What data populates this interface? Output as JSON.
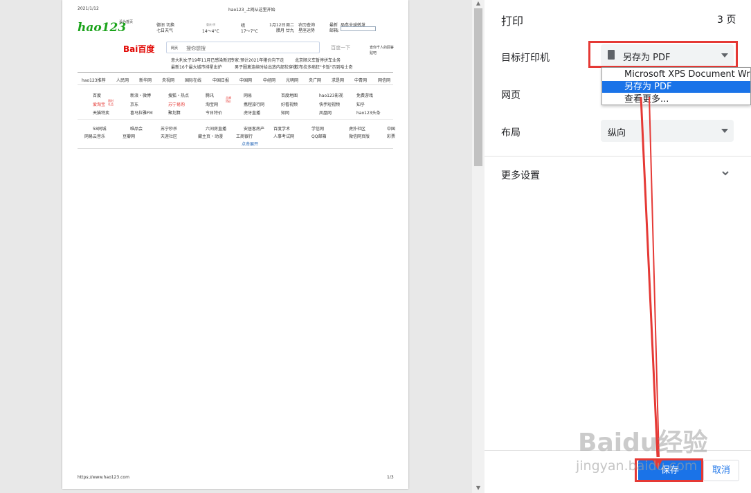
{
  "preview": {
    "header_date": "2021/1/12",
    "header_title": "hao123_上网从这里开始",
    "footer_url": "https://www.hao123.com",
    "footer_page": "1/3",
    "logo_hao": "hao123",
    "set_home": "设为首页",
    "weather": {
      "city": "德旧",
      "switch": "切换",
      "week_weather": "七日天气",
      "today_label": "重庆·阴",
      "today_temp": "14～4°C",
      "tomorrow_label": "晴",
      "tomorrow_temp": "17～7°C",
      "date": "1月12日",
      "weekday": "周二",
      "lunar": "腊月 廿九",
      "search_stock": "农历查询",
      "gold": "星座运势",
      "hot_label": "最新",
      "hot_text": "局参全球转发",
      "mail_label": "邮箱:"
    },
    "baidu_logo": "Bai百度",
    "search_tab": "网页",
    "search_placeholder": "搜你想搜",
    "search_button": "百度一下",
    "search_side": "查你千人的回答",
    "search_side2": "贴吧",
    "news": [
      "意大利女子19年11月已感染新冠",
      "专家:预计2021年猪价向下走",
      "北京顺义车暂停拼车业务",
      "最新16个最大城市排星出炉",
      "男子圈禽连续时给出放内部捡穿搭",
      "拉布拉多病狂\"卡饭\"示到哈士奇"
    ],
    "nav_links": [
      "hao123推荐",
      "人民网",
      "新华网",
      "央视网",
      "国际在线",
      "中国日报",
      "中国网",
      "中经网",
      "光明网",
      "央广网",
      "求是网",
      "中青网",
      "网信网"
    ],
    "sites": [
      [
        "百度",
        "新浪・微博",
        "搜狐・热点",
        "腾讯",
        "网易",
        "百度地图",
        "hao123影视",
        "免费游戏"
      ],
      [
        "爱淘宝",
        "京东",
        "苏宁易购",
        "淘宝网",
        "携程旅行网",
        "好看视频",
        "快手短视频",
        "知乎"
      ],
      [
        "天猫特卖",
        "喜马拉雅FM",
        "聚划算",
        "今日特价",
        "虎牙直播",
        "知网",
        "凤凰网",
        "hao123头条"
      ]
    ],
    "sites2": [
      [
        "58同城",
        "唯品会",
        "苏宁秒杀",
        "六间房直播",
        "安居客房产",
        "百度学术",
        "学信网",
        "虎扑社区",
        "中国"
      ],
      [
        "网易云音乐",
        "豆瓣网",
        "天涯社区",
        "藏主页・动漫",
        "工商银行",
        "人事考试网",
        "QQ邮箱",
        "微信网页版",
        "彩票"
      ]
    ],
    "expand": "点击展开",
    "tag1": "限时\n礼品",
    "tag2": "品牌\n特价"
  },
  "settings": {
    "title": "打印",
    "page_count": "3 页",
    "destination_label": "目标打印机",
    "destination_value": "另存为 PDF",
    "pages_label": "网页",
    "layout_label": "布局",
    "layout_value": "纵向",
    "more_settings": "更多设置",
    "save_button": "保存",
    "cancel_button": "取消"
  },
  "dropdown": {
    "options": [
      "Microsoft XPS Document Writer",
      "另存为 PDF",
      "查看更多..."
    ],
    "selected_index": 1
  },
  "watermark": {
    "line1": "Baidu经验",
    "line2": "jingyan.baidu.com"
  },
  "colors": {
    "accent": "#1a73e8",
    "highlight_box": "#e53935",
    "hao_green": "#1ba31b",
    "hao_orange": "#f08c00"
  }
}
